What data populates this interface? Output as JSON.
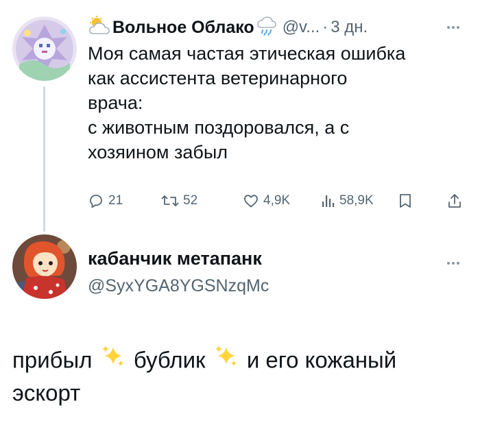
{
  "post": {
    "author_name": "Вольное Облако",
    "handle": "@v...",
    "separator": "·",
    "time": "3 дн.",
    "name_prefix_icon": "sun-behind-cloud-icon",
    "name_suffix_icon": "cloud-with-rain-icon",
    "text": "Моя самая частая этическая ошибка\nкак ассистента ветеринарного\nврача:\nс животным поздоровался, а с\nхозяином забыл",
    "actions": {
      "replies": "21",
      "reposts": "52",
      "likes": "4,9K",
      "views": "58,9K"
    }
  },
  "reply": {
    "author_name": "кабанчик метапанк",
    "handle": "@SyxYGA8YGSNzqMc",
    "text_parts": [
      "прибыл",
      "бублик",
      "и его кожаный эскорт"
    ],
    "sparkle_icon": "sparkles-icon"
  },
  "colors": {
    "text": "#0f1419",
    "secondary": "#536471",
    "thread_line": "#cfd9de"
  }
}
